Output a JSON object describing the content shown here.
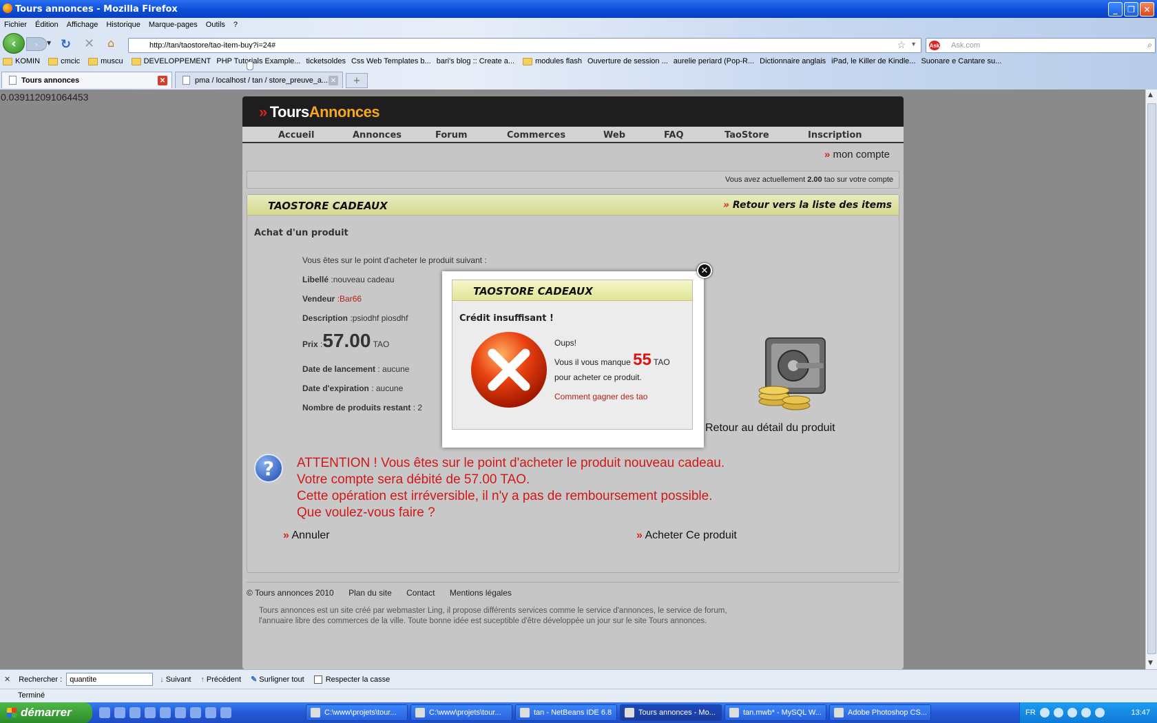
{
  "window": {
    "title": "Tours annonces - Mozilla Firefox"
  },
  "menu": [
    "Fichier",
    "Édition",
    "Affichage",
    "Historique",
    "Marque-pages",
    "Outils",
    "?"
  ],
  "url": "http://tan/taostore/tao-item-buy?i=24#",
  "search_placeholder": "Ask.com",
  "bookmarks": [
    "KOMIN",
    "cmcic",
    "muscu",
    "DEVELOPPEMENT",
    "PHP Tutorials Example...",
    "ticketsoldes",
    "Css Web Templates b...",
    "bari's blog :: Create a...",
    "modules flash",
    "Ouverture de session ...",
    "aurelie periard (Pop-R...",
    "Dictionnaire anglais",
    "iPad, le Killer de Kindle...",
    "Suonare e Cantare su..."
  ],
  "tabs": [
    {
      "label": "Tours annonces"
    },
    {
      "label": "pma / localhost / tan / store_preuve_a..."
    }
  ],
  "debug_value": "0.039112091064453",
  "site": {
    "logo_1": "Tours",
    "logo_2": "Annonces",
    "nav": [
      "Accueil",
      "Annonces",
      "Forum",
      "Commerces",
      "Web",
      "FAQ",
      "TaoStore",
      "Inscription"
    ],
    "account_link": "mon compte",
    "balance_pre": "Vous avez actuellement",
    "balance": "2.00",
    "balance_post": "tao sur votre compte"
  },
  "store": {
    "title": "TAOSTORE CADEAUX",
    "back_link": "Retour vers la liste des items",
    "heading": "Achat d'un produit",
    "intro": "Vous êtes sur le point d'acheter le produit suivant :",
    "libelle_label": "Libellé",
    "libelle": ":nouveau cadeau",
    "vendeur_label": "Vendeur",
    "vendeur": ":Bar66",
    "description_label": "Description",
    "description": ":psiodhf piosdhf",
    "prix_label": "Prix",
    "prix_sep": ":",
    "prix": "57.00",
    "prix_unit": "TAO",
    "lancement_label": "Date de lancement",
    "lancement": ": aucune",
    "expiration_label": "Date d'expiration",
    "expiration": ": aucune",
    "restant_label": "Nombre de produits restant",
    "restant": ": 2",
    "detail_link": "Retour au détail du produit",
    "warning": [
      "ATTENTION ! Vous êtes sur le point d'acheter le produit nouveau cadeau.",
      "Votre compte sera débité de 57.00 TAO.",
      "Cette opération est irréversible, il n'y a pas de remboursement possible.",
      "Que voulez-vous faire ?"
    ],
    "cancel": "Annuler",
    "buy": "Acheter Ce produit"
  },
  "footer": {
    "links": [
      "© Tours annonces 2010",
      "Plan du site",
      "Contact",
      "Mentions légales"
    ],
    "desc_1": "Tours annonces est un site créé par webmaster Ling, il propose différents services comme le service d'annonces, le service de forum,",
    "desc_2": "l'annuaire libre des commerces de la ville. Toute bonne idée est suceptible d'être développée un jour sur le site Tours annonces."
  },
  "modal": {
    "title": "TAOSTORE CADEAUX",
    "heading": "Crédit insuffisant !",
    "oups": "Oups!",
    "missing_pre": "Vous il vous manque",
    "missing_amount": "55",
    "missing_unit": "TAO",
    "missing_post": "pour acheter ce produit.",
    "link": "Comment gagner des tao"
  },
  "findbar": {
    "label": "Rechercher :",
    "value": "quantite",
    "next": "Suivant",
    "prev": "Précédent",
    "highlight": "Surligner tout",
    "matchcase": "Respecter la casse"
  },
  "status": "Terminé",
  "taskbar": {
    "start": "démarrer",
    "items": [
      "C:\\www\\projets\\tour...",
      "C:\\www\\projets\\tour...",
      "tan - NetBeans IDE 6.8",
      "Tours annonces - Mo...",
      "tan.mwb* - MySQL W...",
      "Adobe Photoshop CS..."
    ],
    "lang": "FR",
    "clock": "13:47"
  }
}
